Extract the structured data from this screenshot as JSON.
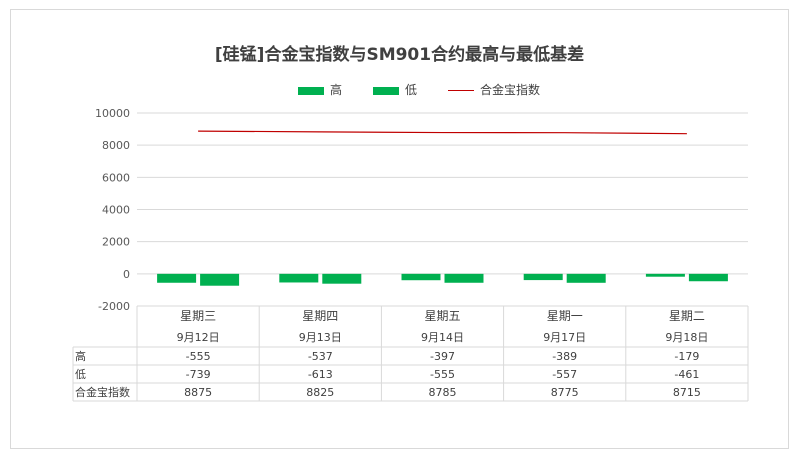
{
  "chart_data": {
    "type": "bar",
    "title": "[硅锰]合金宝指数与SM901合约最高与最低基差",
    "categories": [
      "星期三",
      "星期四",
      "星期五",
      "星期一",
      "星期二"
    ],
    "dates": [
      "9月12日",
      "9月13日",
      "9月14日",
      "9月17日",
      "9月18日"
    ],
    "series": [
      {
        "name": "高",
        "type": "bar",
        "color": "#00b050",
        "values": [
          -555,
          -537,
          -397,
          -389,
          -179
        ]
      },
      {
        "name": "低",
        "type": "bar",
        "color": "#00b050",
        "values": [
          -739,
          -613,
          -555,
          -557,
          -461
        ]
      },
      {
        "name": "合金宝指数",
        "type": "line",
        "color": "#c00000",
        "values": [
          8875,
          8825,
          8785,
          8775,
          8715
        ]
      }
    ],
    "ylim": [
      -2000,
      10000
    ],
    "yticks": [
      -2000,
      0,
      2000,
      4000,
      6000,
      8000,
      10000
    ],
    "grid": true,
    "legend": "top",
    "data_table": true
  }
}
